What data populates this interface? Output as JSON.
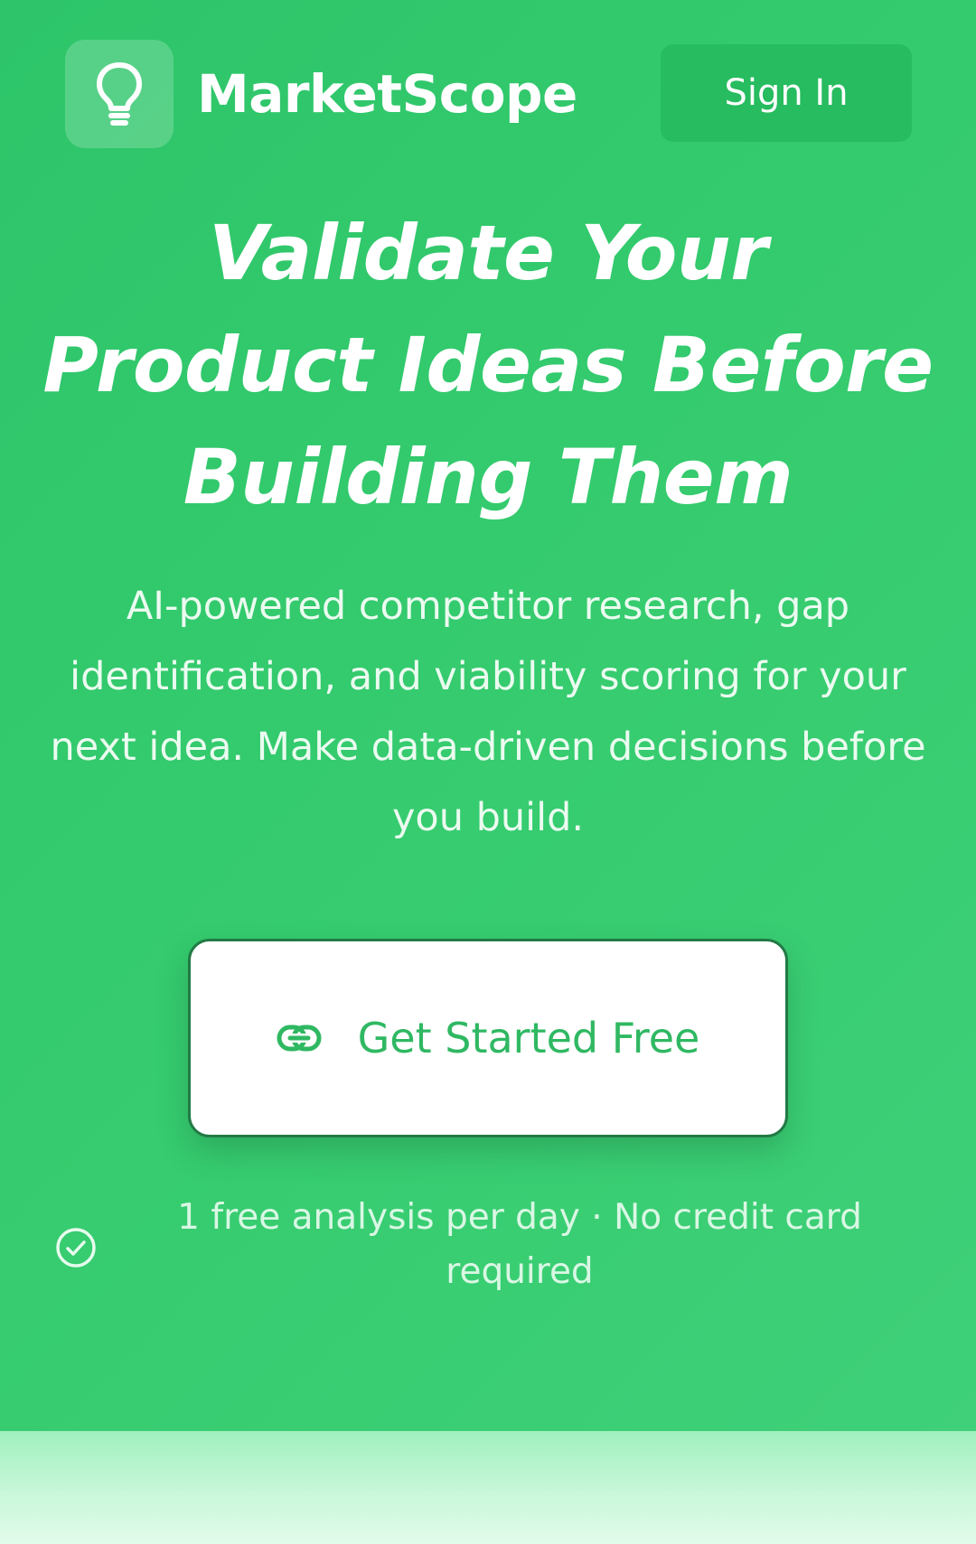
{
  "header": {
    "brand": "MarketScope",
    "logo_icon": "lightbulb-icon",
    "sign_in_label": "Sign In"
  },
  "hero": {
    "headline": "Validate Your Product Ideas Before Building Them",
    "subtext": "AI-powered competitor research, gap identification, and viability scoring for your next idea. Make data-driven decisions before you build.",
    "cta_label": "Get Started Free",
    "cta_icon": "link-icon",
    "note": "1 free analysis per day · No credit card required",
    "note_icon": "check-circle-icon"
  },
  "colors": {
    "hero_background": "#32c86d",
    "accent_green": "#2fb862",
    "cta_border": "#227a45"
  }
}
